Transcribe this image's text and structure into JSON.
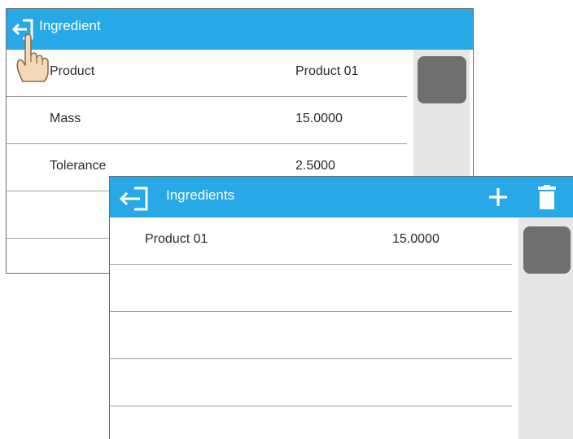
{
  "back_panel": {
    "title": "Ingredient",
    "rows": [
      {
        "label": "Product",
        "value": "Product 01"
      },
      {
        "label": "Mass",
        "value": "15.0000"
      },
      {
        "label": "Tolerance",
        "value": "2.5000"
      },
      {
        "label": "",
        "value": ""
      }
    ]
  },
  "front_panel": {
    "title": "Ingredients",
    "rows": [
      {
        "label": "Product 01",
        "value": "15.0000"
      },
      {
        "label": "",
        "value": ""
      },
      {
        "label": "",
        "value": ""
      },
      {
        "label": "",
        "value": ""
      },
      {
        "label": "",
        "value": ""
      }
    ]
  },
  "icons": {
    "back": "exit-arrow-icon",
    "add": "plus-icon",
    "delete": "trash-icon",
    "pointer": "hand-pointer-icon"
  },
  "colors": {
    "header": "#28a8e6",
    "scroll_track": "#e6e6e6",
    "scroll_thumb": "#6f6f6f"
  }
}
